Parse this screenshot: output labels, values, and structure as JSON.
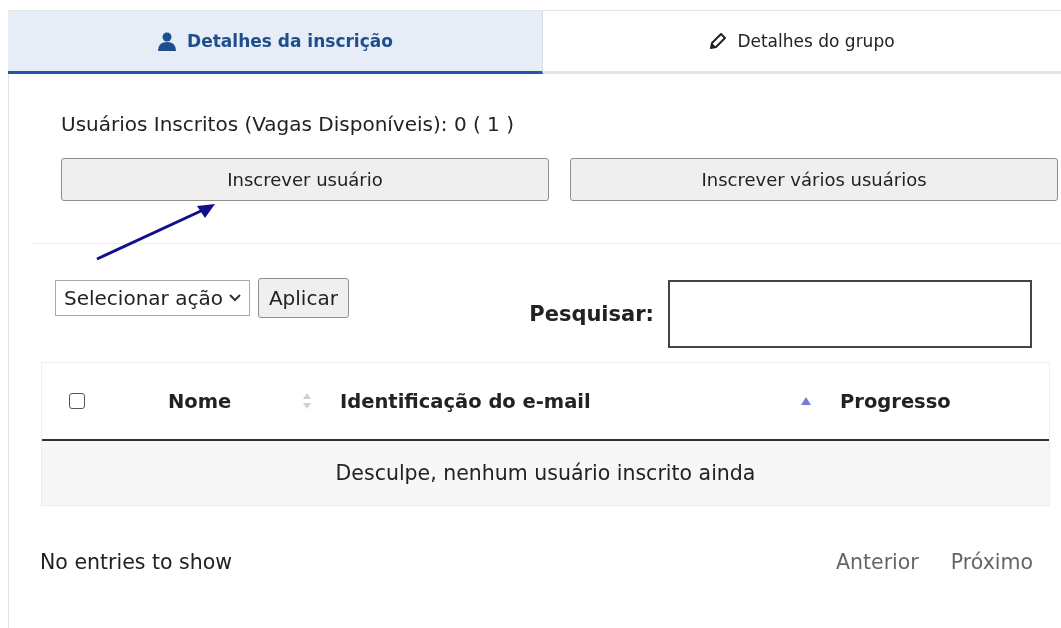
{
  "tabs": [
    {
      "label": "Detalhes da inscrição",
      "selected": true
    },
    {
      "label": "Detalhes do grupo",
      "selected": false
    }
  ],
  "summary": "Usuários Inscritos (Vagas Disponíveis): 0 ( 1 )",
  "buttons": [
    "Inscrever usuário",
    "Inscrever vários usuários"
  ],
  "annotation": {
    "kind": "arrow"
  },
  "bulk_action": {
    "value": "Selecionar ação",
    "apply": "Aplicar"
  },
  "search": {
    "label": "Pesquisar:"
  },
  "table": {
    "select_all": {
      "checked": false
    },
    "columns": [
      {
        "label": "Nome",
        "kind": "sortable"
      },
      {
        "label": "Identificação do e-mail",
        "kind": "sorted"
      },
      {
        "label": "Progresso",
        "kind": "plain"
      }
    ],
    "empty_message": "Desculpe, nenhum usuário inscrito ainda"
  },
  "footer": {
    "info": "No entries to show",
    "pagination": [
      {
        "label": "Anterior",
        "disabled": true
      },
      {
        "label": "Próximo",
        "disabled": true
      }
    ]
  }
}
